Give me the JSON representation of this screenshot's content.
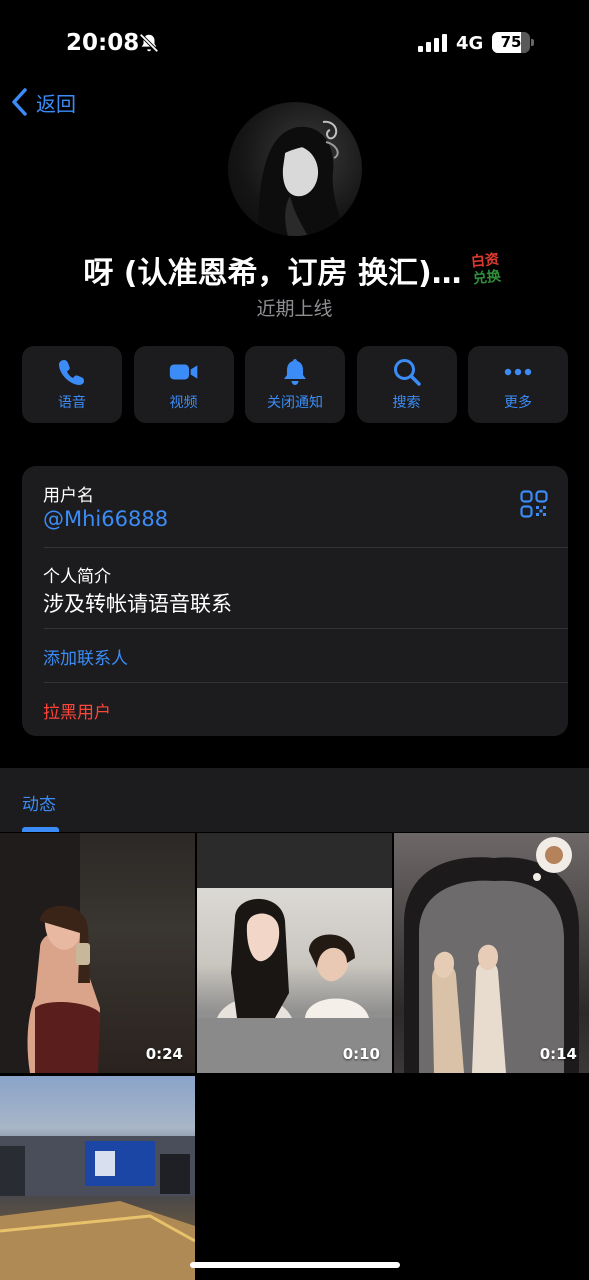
{
  "status_bar": {
    "time": "20:08",
    "network": "4G",
    "battery_percent": 75,
    "battery_label": "75",
    "icons": [
      "bell-slash-icon",
      "signal-bars-icon",
      "battery-icon"
    ]
  },
  "nav": {
    "back_label": "返回",
    "back_icon": "chevron-left-icon"
  },
  "profile": {
    "name": "呀 (认准恩希，订房 换汇)…",
    "badge_line1": "白资",
    "badge_line2": "兑换",
    "status": "近期上线"
  },
  "actions": [
    {
      "label": "语音",
      "icon": "phone-icon"
    },
    {
      "label": "视频",
      "icon": "video-camera-icon"
    },
    {
      "label": "关闭通知",
      "icon": "bell-icon"
    },
    {
      "label": "搜索",
      "icon": "search-icon"
    },
    {
      "label": "更多",
      "icon": "more-dots-icon"
    }
  ],
  "info": {
    "username_label": "用户名",
    "username_value": "@Mhi66888",
    "bio_label": "个人简介",
    "bio_value": "涉及转帐请语音联系",
    "add_contact": "添加联系人",
    "block_user": "拉黑用户"
  },
  "media": {
    "tab_label": "动态",
    "items": [
      {
        "duration": "0:24"
      },
      {
        "duration": "0:10"
      },
      {
        "duration": "0:14"
      },
      {
        "duration": ""
      }
    ]
  },
  "colors": {
    "accent": "#3b8cf6",
    "danger": "#ff453a",
    "card": "#1c1c1e",
    "background": "#000000",
    "secondary_text": "#8e8e93"
  }
}
